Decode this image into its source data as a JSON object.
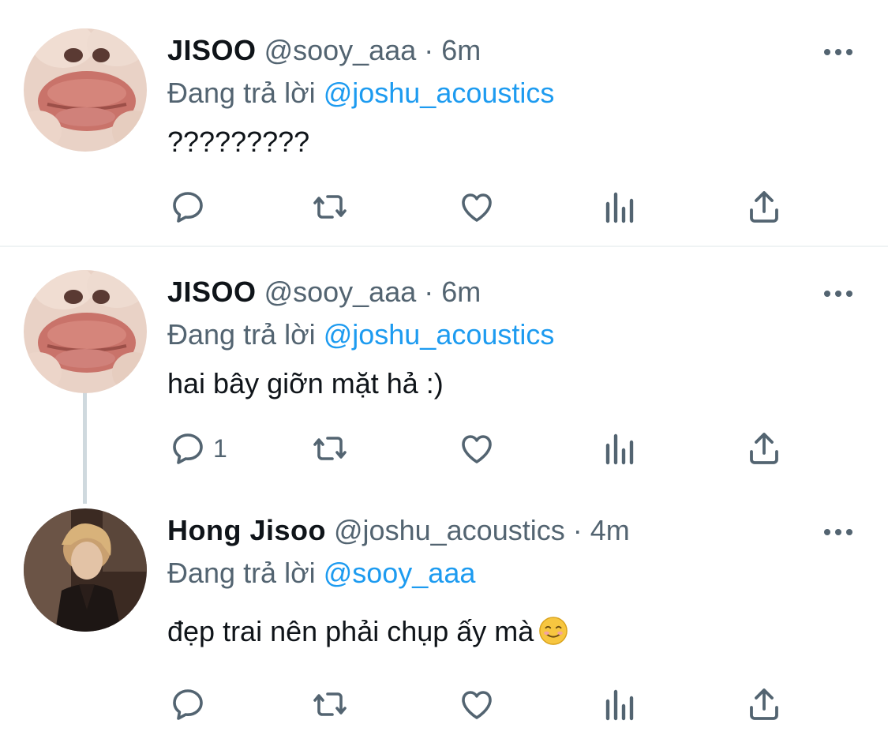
{
  "tweets": [
    {
      "name": "JISOO",
      "handle": "@sooy_aaa",
      "time": "6m",
      "replying_prefix": "Đang trả lời ",
      "replying_to": "@joshu_acoustics",
      "text": "?????????",
      "reply_count": "",
      "avatar": "lips-closeup-avatar"
    },
    {
      "name": "JISOO",
      "handle": "@sooy_aaa",
      "time": "6m",
      "replying_prefix": "Đang trả lời ",
      "replying_to": "@joshu_acoustics",
      "text": "hai bây giỡn mặt hả :)",
      "reply_count": "1",
      "avatar": "lips-closeup-avatar"
    },
    {
      "name": "Hong Jisoo",
      "handle": "@joshu_acoustics",
      "time": "4m",
      "replying_prefix": "Đang trả lời ",
      "replying_to": "@sooy_aaa",
      "text": "đẹp trai nên phải chụp ấy mà",
      "reply_count": "",
      "avatar": "person-photo-avatar",
      "emoji": "smiling-face-emoji"
    }
  ],
  "separator": " · ",
  "icons": [
    "reply-icon",
    "retweet-icon",
    "like-icon",
    "views-icon",
    "share-icon",
    "more-icon"
  ],
  "colors": {
    "text": "#0f1419",
    "secondary": "#536471",
    "link": "#1d9bf0",
    "thread_line": "#cfd9de"
  }
}
